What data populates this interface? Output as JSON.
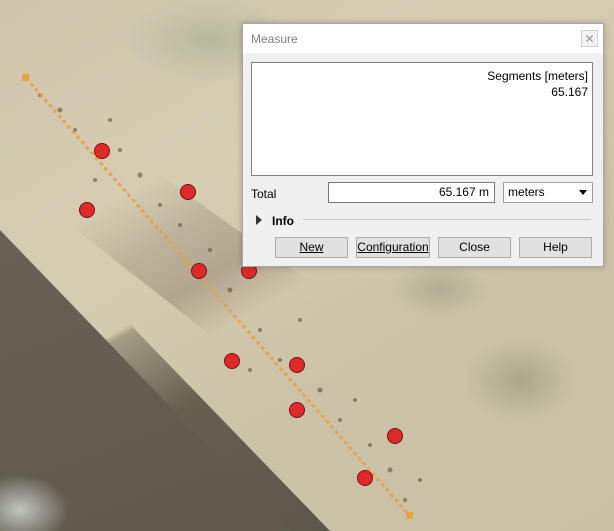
{
  "map": {
    "measure_line_color": "#e8a040",
    "point_color": "#e02a2a",
    "point_count": 13
  },
  "dialog": {
    "title": "Measure",
    "close_icon": "close-icon",
    "segments": {
      "header": "Segments [meters]",
      "values": [
        "65.167"
      ]
    },
    "total": {
      "label": "Total",
      "value": "65.167 m"
    },
    "units": {
      "selected": "meters"
    },
    "info": {
      "label": "Info"
    },
    "buttons": {
      "new": "New",
      "configuration": "Configuration",
      "close": "Close",
      "help": "Help"
    }
  }
}
